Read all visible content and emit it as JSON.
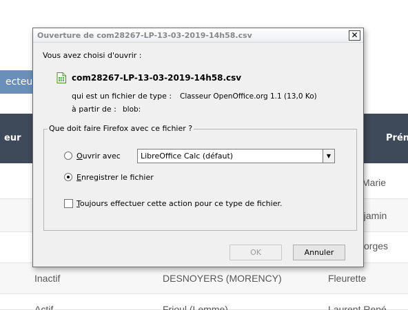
{
  "background": {
    "tab_fragment": "ecteu",
    "header": {
      "col1_fragment": "eur",
      "col_prenom_fragment": "Prén"
    },
    "rows": [
      {
        "status": "",
        "name": "",
        "prenom": "Marie"
      },
      {
        "status": "",
        "name": "",
        "prenom": "njamin"
      },
      {
        "status": "",
        "name": "",
        "prenom": "orges"
      },
      {
        "status": "Inactif",
        "name": "DESNOYERS (MORENCY)",
        "prenom": "Fleurette"
      },
      {
        "status": "Actif",
        "name": "Frioul (Lemme)",
        "prenom": "Laurent René"
      }
    ]
  },
  "dialog": {
    "title": "Ouverture de com28267-LP-13-03-2019-14h58.csv",
    "close_label": "✕",
    "intro": "Vous avez choisi d'ouvrir :",
    "file_icon": "spreadsheet-file-icon",
    "filename": "com28267-LP-13-03-2019-14h58.csv",
    "type_prefix": "qui est un fichier de type :",
    "type_value": "Classeur OpenOffice.org 1.1 (13,0 Ko)",
    "from_prefix": "à partir de :",
    "from_value": "blob:",
    "group_label": "Que doit faire Firefox avec ce fichier ?",
    "open_with": {
      "accel": "O",
      "rest": "uvrir avec",
      "app": "LibreOffice Calc (défaut)",
      "selected": false
    },
    "save_file": {
      "accel": "E",
      "rest": "nregistrer le fichier",
      "selected": true
    },
    "always": {
      "accel": "T",
      "rest": "oujours effectuer cette action pour ce type de fichier.",
      "checked": false
    },
    "ok_label": "OK",
    "cancel_label": "Annuler"
  }
}
